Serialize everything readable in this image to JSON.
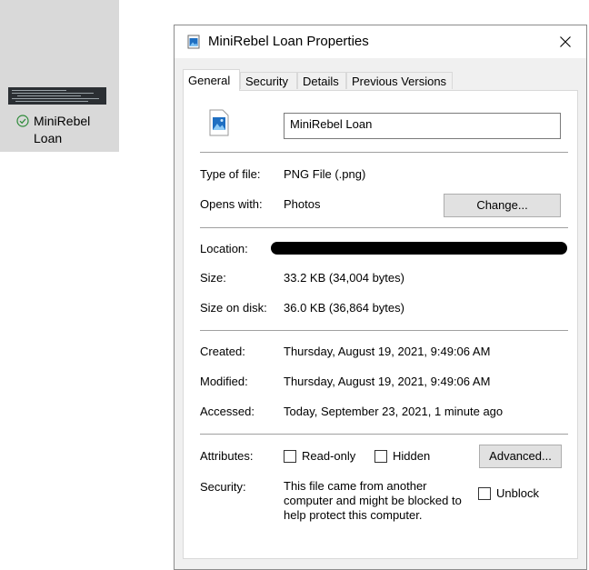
{
  "desktop": {
    "icon_label_line1": "MiniRebel",
    "icon_label_line2": "Loan",
    "sync_icon": "check-circle-icon"
  },
  "dialog": {
    "title": "MiniRebel Loan Properties",
    "close_icon": "close-icon",
    "tabs": [
      {
        "label": "General",
        "active": true
      },
      {
        "label": "Security",
        "active": false
      },
      {
        "label": "Details",
        "active": false
      },
      {
        "label": "Previous Versions",
        "active": false
      }
    ],
    "file_name": "MiniRebel Loan",
    "type_label": "Type of file:",
    "type_value": "PNG File (.png)",
    "opens_label": "Opens with:",
    "opens_value": "Photos",
    "change_button": "Change...",
    "location_label": "Location:",
    "size_label": "Size:",
    "size_value": "33.2 KB (34,004 bytes)",
    "size_disk_label": "Size on disk:",
    "size_disk_value": "36.0 KB (36,864 bytes)",
    "created_label": "Created:",
    "created_value": "Thursday, August 19, 2021, 9:49:06 AM",
    "modified_label": "Modified:",
    "modified_value": "Thursday, August 19, 2021, 9:49:06 AM",
    "accessed_label": "Accessed:",
    "accessed_value": "Today, September 23, 2021, 1 minute ago",
    "attributes_label": "Attributes:",
    "readonly_label": "Read-only",
    "hidden_label": "Hidden",
    "advanced_button": "Advanced...",
    "security_label": "Security:",
    "security_line1": "This file came from another",
    "security_line2": "computer and might be blocked to",
    "security_line3": "help protect this computer.",
    "unblock_label": "Unblock"
  }
}
